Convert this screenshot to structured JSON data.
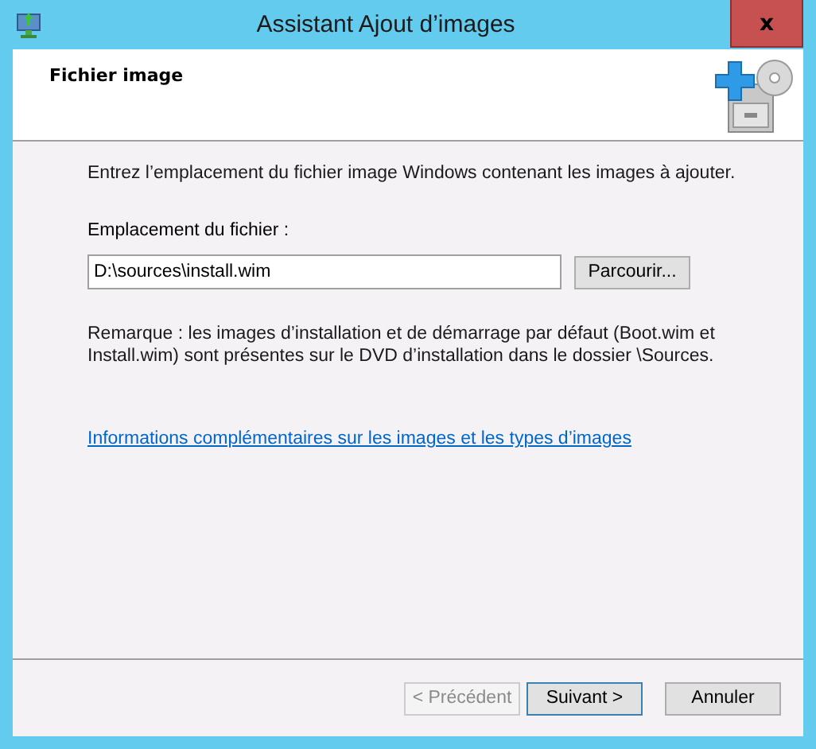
{
  "window": {
    "title": "Assistant Ajout d’images",
    "close": "x"
  },
  "header": {
    "title": "Fichier image"
  },
  "intro": "Entrez l’emplacement du fichier image Windows contenant les images à ajouter.",
  "file_field": {
    "label": "Emplacement du fichier :",
    "value": "D:\\sources\\install.wim",
    "browse": "Parcourir..."
  },
  "note": "Remarque : les images d’installation et de démarrage par défaut (Boot.wim et Install.wim) sont présentes sur le DVD d’installation dans le dossier \\Sources.",
  "link": "Informations complémentaires sur les images et les types d’images",
  "buttons": [
    {
      "label": "< Précédent",
      "disabled": true,
      "default": false
    },
    {
      "label": "Suivant >",
      "disabled": false,
      "default": true
    },
    {
      "label": "Annuler",
      "disabled": false,
      "default": false
    }
  ]
}
